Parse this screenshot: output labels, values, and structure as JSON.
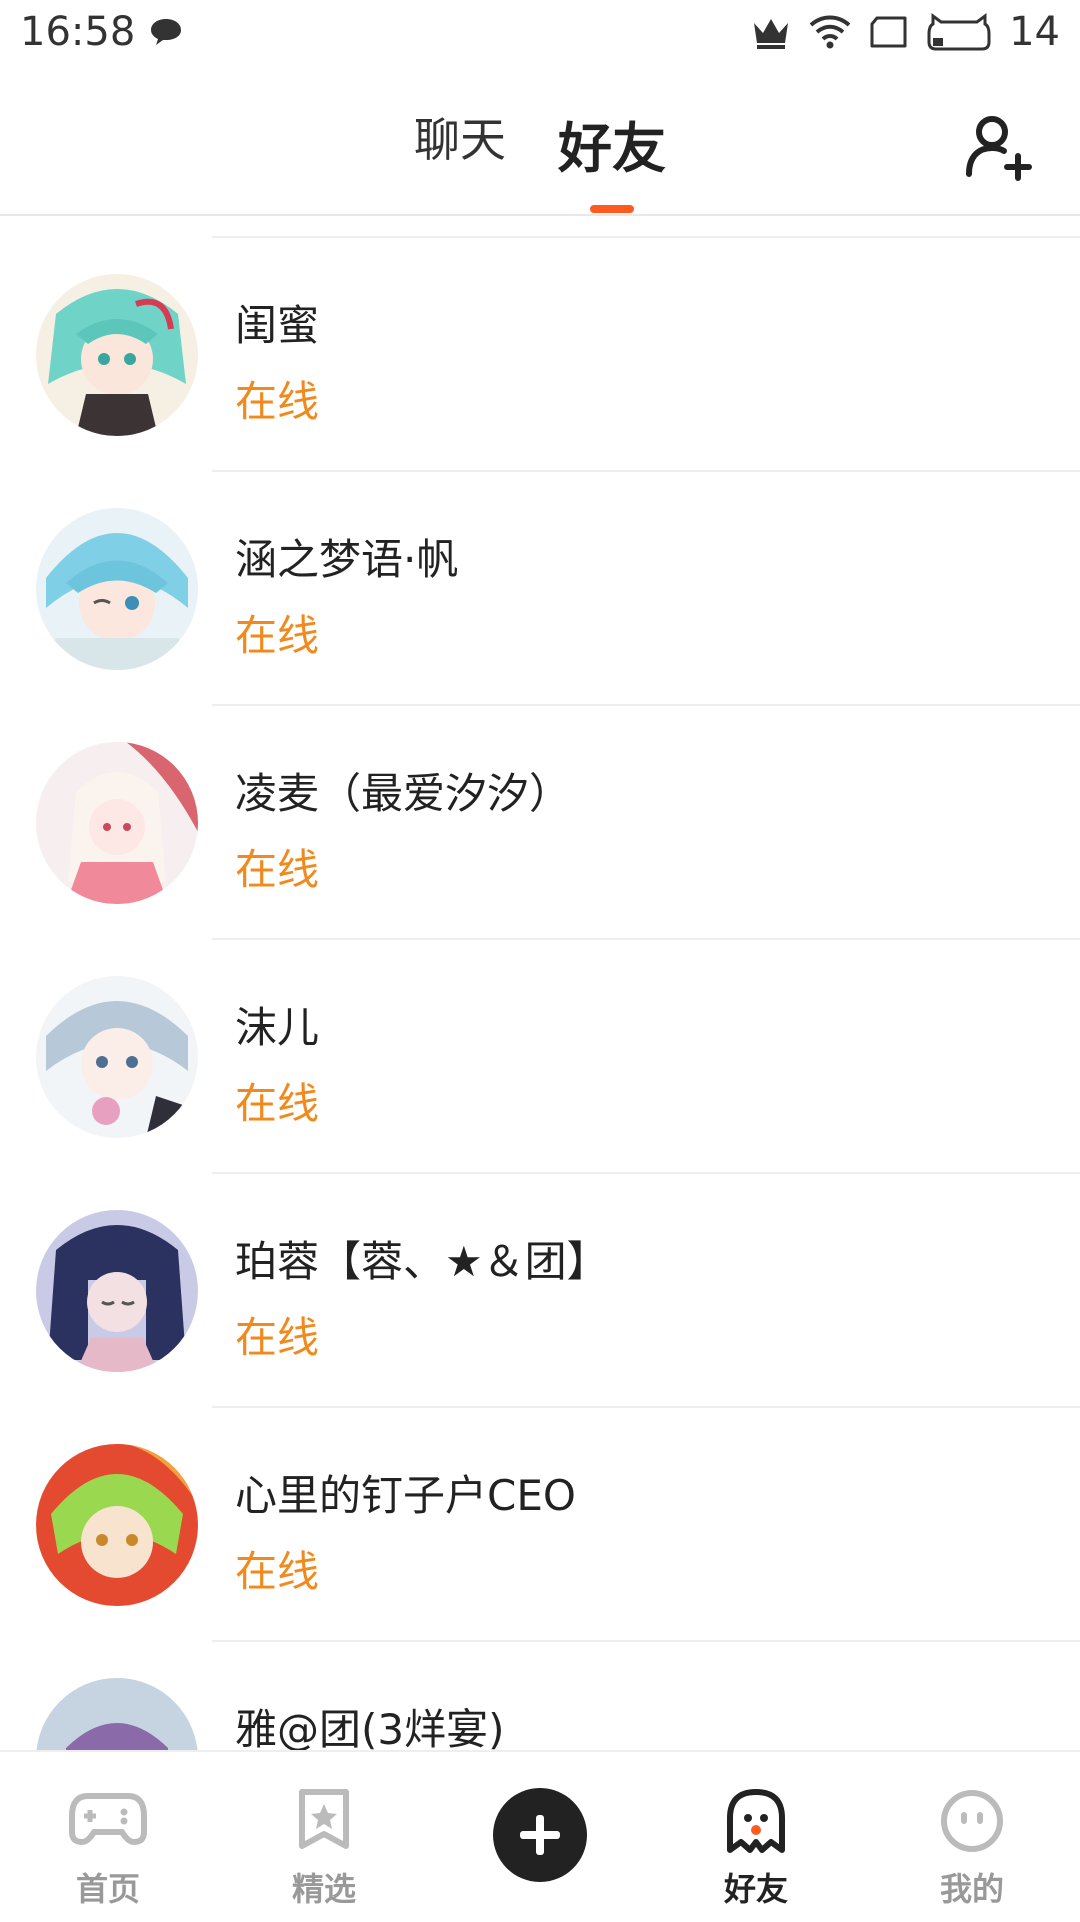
{
  "status_bar": {
    "time": "16:58",
    "battery": "14",
    "icons": [
      "chat-bubble-icon",
      "crown-icon",
      "wifi-icon",
      "sim-card-icon",
      "battery-cat-icon"
    ]
  },
  "header": {
    "tabs": [
      {
        "label": "聊天",
        "active": false
      },
      {
        "label": "好友",
        "active": true
      }
    ],
    "accent_color": "#ff5a1f",
    "add_friend_icon": "add-user-icon"
  },
  "friends": [
    {
      "name": "闺蜜",
      "status": "在线"
    },
    {
      "name": "涵之梦语·帆",
      "status": "在线"
    },
    {
      "name": "凌麦（最爱汐汐）",
      "status": "在线"
    },
    {
      "name": "沫儿",
      "status": "在线"
    },
    {
      "name": "珀蓉【蓉、★＆团】",
      "status": "在线"
    },
    {
      "name": "心里的钉子户CEO",
      "status": "在线"
    },
    {
      "name": "雅@团(3烊宴)",
      "status": ""
    }
  ],
  "status_color": "#f08a1e",
  "bottom_nav": {
    "items": [
      {
        "label": "首页",
        "icon": "gamepad-icon",
        "active": false
      },
      {
        "label": "精选",
        "icon": "star-bookmark-icon",
        "active": false
      },
      {
        "label": "",
        "icon": "plus-icon",
        "active": false
      },
      {
        "label": "好友",
        "icon": "ghost-icon",
        "active": true
      },
      {
        "label": "我的",
        "icon": "face-icon",
        "active": false
      }
    ]
  }
}
